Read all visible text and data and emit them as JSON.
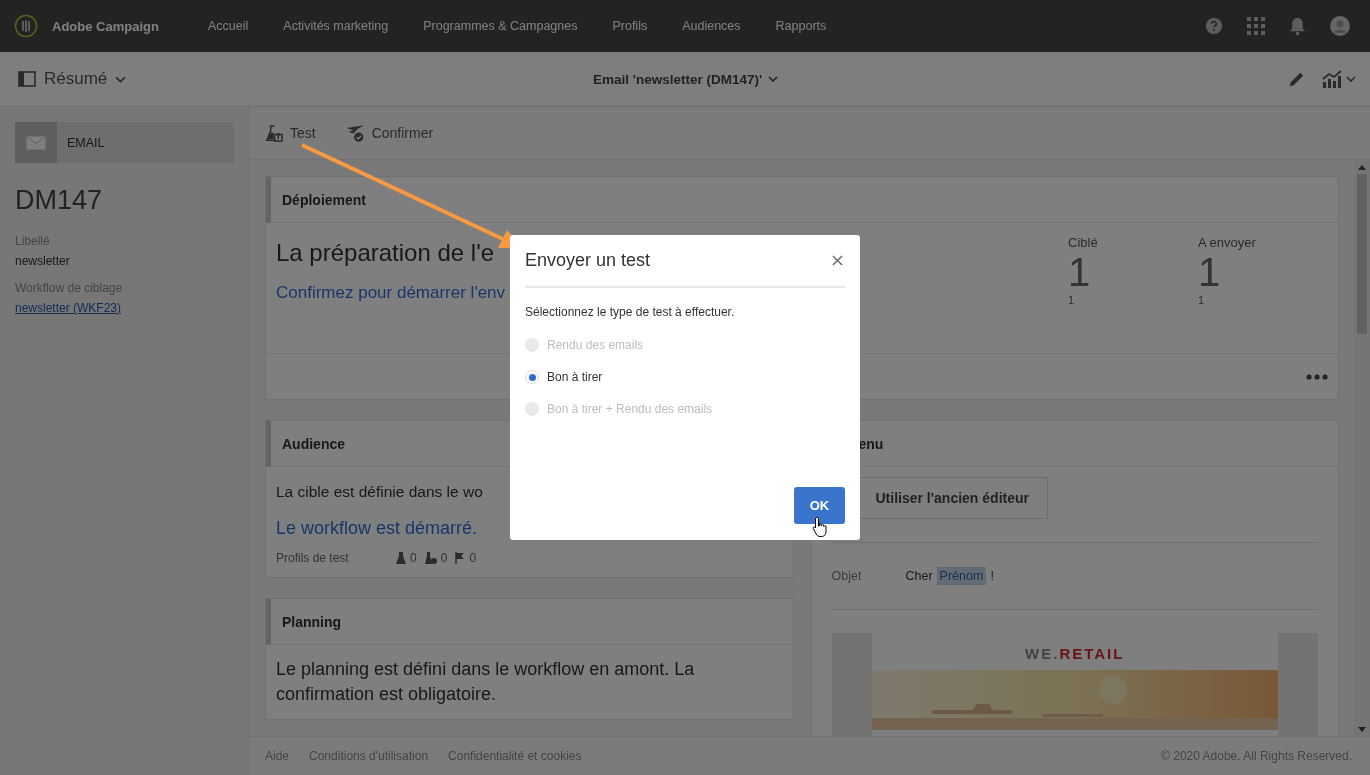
{
  "app_bar": {
    "product": "Adobe Campaign",
    "nav": [
      {
        "label": "Accueil"
      },
      {
        "label": "Activités marketing"
      },
      {
        "label": "Programmes & Campagnes"
      },
      {
        "label": "Profils"
      },
      {
        "label": "Audiences"
      },
      {
        "label": "Rapports"
      }
    ]
  },
  "header": {
    "view": "Résumé",
    "title": "Email 'newsletter (DM147)'"
  },
  "sidebar": {
    "type": "EMAIL",
    "code": "DM147",
    "fields": [
      {
        "label": "Libellé",
        "value": "newsletter",
        "link": false
      },
      {
        "label": "Workflow de ciblage",
        "value": "newsletter (WKF23)",
        "link": true
      }
    ]
  },
  "toolbar": [
    {
      "label": "Test",
      "kind": "test"
    },
    {
      "label": "Confirmer",
      "kind": "confirm"
    }
  ],
  "deployment": {
    "title": "Déploiement",
    "message": "La préparation de l'e",
    "action": "Confirmez pour démarrer l'env",
    "stats": [
      {
        "label": "Ciblé",
        "value": "1",
        "detail": "1"
      },
      {
        "label": "A envoyer",
        "value": "1",
        "detail": "1"
      }
    ]
  },
  "audience": {
    "title": "Audience",
    "message": "La cible est définie dans le wo",
    "status": "Le workflow est démarré.",
    "test_profiles": {
      "label": "Profils de test",
      "counts": [
        {
          "kind": "flask",
          "value": "0"
        },
        {
          "kind": "flask-check",
          "value": "0"
        },
        {
          "kind": "flag",
          "value": "0"
        }
      ]
    }
  },
  "planning": {
    "title": "Planning",
    "message": "Le planning est défini dans le workflow en amont. La confirmation est obligatoire."
  },
  "content": {
    "title": "enu",
    "editor_button": "Utiliser l'ancien éditeur",
    "subject_label": "Objet",
    "subject_prefix": "Cher",
    "subject_field": "Prénom",
    "subject_suffix": "!",
    "preview": {
      "brand": "WE.",
      "brand_accent": "RETAIL"
    }
  },
  "footer": {
    "links": [
      "Aide",
      "Conditions d'utilisation",
      "Confidentialité et cookies"
    ],
    "copyright": "© 2020 Adobe. All Rights Reserved."
  },
  "dialog": {
    "title": "Envoyer un test",
    "prompt": "Sélectionnez le type de test à effectuer.",
    "options": [
      {
        "label": "Rendu des emails",
        "selected": false,
        "disabled": true
      },
      {
        "label": "Bon à tirer",
        "selected": true,
        "disabled": false
      },
      {
        "label": "Bon à tirer + Rendu des emails",
        "selected": false,
        "disabled": true
      }
    ],
    "ok": "OK"
  }
}
